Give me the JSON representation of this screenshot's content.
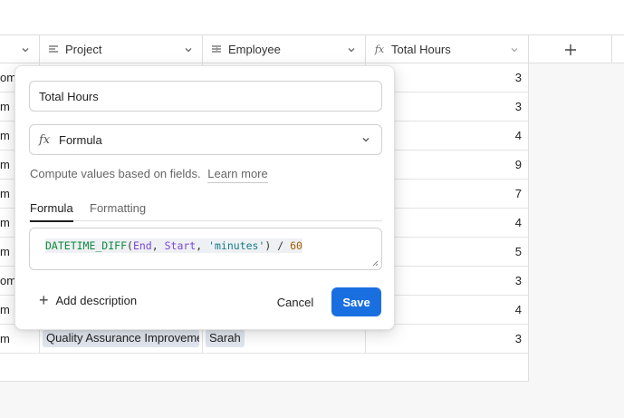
{
  "header": {
    "columns": [
      {
        "label": "",
        "icon": "chevron-down-icon"
      },
      {
        "label": "Project",
        "icon": "long-text-icon"
      },
      {
        "label": "Employee",
        "icon": "link-record-icon"
      },
      {
        "label": "Total Hours",
        "icon": "formula-icon"
      }
    ],
    "add_column_icon": "plus-icon"
  },
  "rows": [
    {
      "c0": "om",
      "project": "",
      "employee": "",
      "hours": "3"
    },
    {
      "c0": "m",
      "project": "",
      "employee": "",
      "hours": "3"
    },
    {
      "c0": "m",
      "project": "",
      "employee": "",
      "hours": "4"
    },
    {
      "c0": "m",
      "project": "",
      "employee": "",
      "hours": "9"
    },
    {
      "c0": "m",
      "project": "",
      "employee": "",
      "hours": "7"
    },
    {
      "c0": "m",
      "project": "",
      "employee": "",
      "hours": "4"
    },
    {
      "c0": "m",
      "project": "",
      "employee": "",
      "hours": "5"
    },
    {
      "c0": "om",
      "project": "",
      "employee": "",
      "hours": "3"
    },
    {
      "c0": "m",
      "project": "",
      "employee": "",
      "hours": "4"
    },
    {
      "c0": "m",
      "project": "Quality Assurance Improvement",
      "employee": "Sarah",
      "hours": "3"
    }
  ],
  "dialog": {
    "field_name": "Total Hours",
    "field_type": "Formula",
    "field_type_icon": "fx",
    "help_text": "Compute values based on fields.",
    "learn_more": "Learn more",
    "tabs": [
      "Formula",
      "Formatting"
    ],
    "active_tab": "Formula",
    "formula": {
      "fn": "DATETIME_DIFF",
      "open": "(",
      "arg1": "End",
      "comma1": ", ",
      "arg2": "Start",
      "comma2": ", ",
      "arg3": "'minutes'",
      "close_op": ") / ",
      "divisor": "60"
    },
    "add_description": "Add description",
    "cancel": "Cancel",
    "save": "Save"
  },
  "colors": {
    "save_button": "#1a6fe0",
    "chip_background": "#e1e6ee"
  }
}
